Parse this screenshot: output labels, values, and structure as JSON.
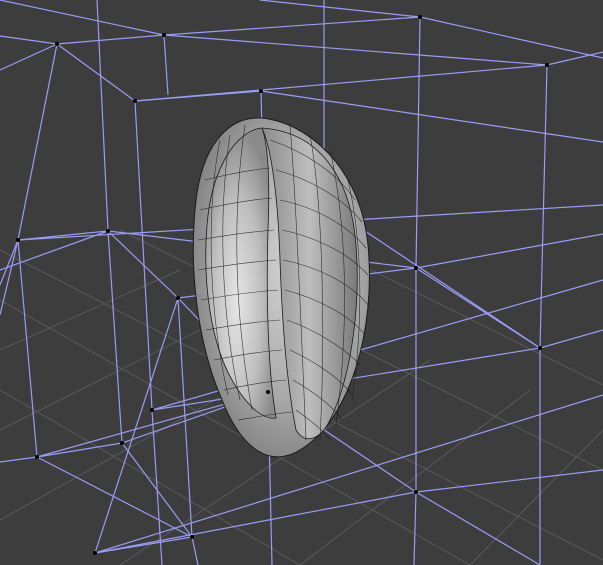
{
  "viewport": {
    "view": "3d-perspective",
    "background_color": "#3d3d3d",
    "floor_grid_color": "#5a5a5a",
    "cage_wire_color": "#9a9cf5",
    "cage_vertex_color": "#000000",
    "mesh_fill_color": "#b4b4b4",
    "mesh_wire_color": "#1a1a1a"
  },
  "objects": [
    {
      "name": "lattice-cage",
      "type": "wireframe-lattice"
    },
    {
      "name": "ring-mesh",
      "type": "subdivided-torus"
    }
  ]
}
